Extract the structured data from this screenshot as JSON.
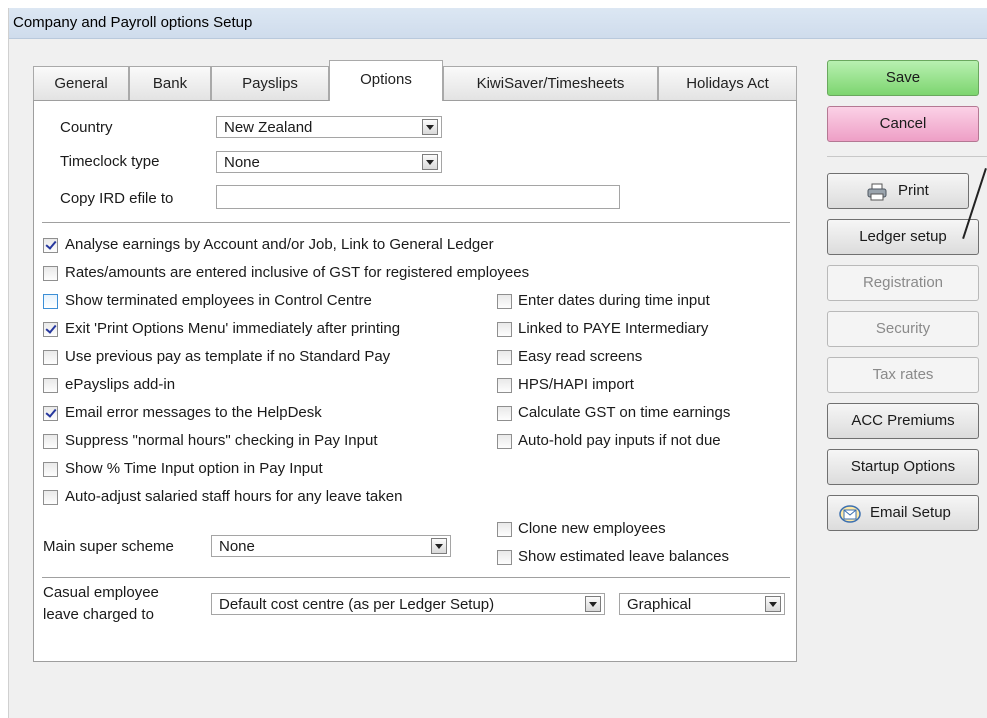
{
  "window": {
    "title": "Company and Payroll options Setup"
  },
  "tabs": [
    {
      "label": "General"
    },
    {
      "label": "Bank"
    },
    {
      "label": "Payslips"
    },
    {
      "label": "Options",
      "active": true
    },
    {
      "label": "KiwiSaver/Timesheets"
    },
    {
      "label": "Holidays Act"
    }
  ],
  "fields": {
    "country": {
      "label": "Country",
      "value": "New Zealand"
    },
    "timeclock": {
      "label": "Timeclock type",
      "value": "None"
    },
    "ird_efile": {
      "label": "Copy IRD efile to",
      "value": ""
    },
    "super_scheme": {
      "label": "Main super scheme",
      "value": "None"
    },
    "casual_leave": {
      "label_line1": "Casual employee",
      "label_line2": "leave charged to",
      "value": "Default cost centre (as per Ledger Setup)",
      "mode": "Graphical"
    }
  },
  "options_left": [
    {
      "label": "Analyse earnings by Account and/or Job, Link to General Ledger",
      "checked": true
    },
    {
      "label": "Rates/amounts are entered inclusive of GST for registered employees",
      "checked": false
    },
    {
      "label": "Show terminated employees in Control Centre",
      "checked": false
    },
    {
      "label": "Exit 'Print Options Menu' immediately after printing",
      "checked": true
    },
    {
      "label": "Use previous pay as template if no Standard Pay",
      "checked": false
    },
    {
      "label": "ePayslips add-in",
      "checked": false
    },
    {
      "label": "Email error messages to the HelpDesk",
      "checked": true
    },
    {
      "label": "Suppress \"normal hours\" checking in Pay Input",
      "checked": false
    },
    {
      "label": "Show % Time Input option in Pay Input",
      "checked": false
    },
    {
      "label": "Auto-adjust salaried staff hours for any leave taken",
      "checked": false
    }
  ],
  "options_right": [
    {
      "label": "Enter dates during time input",
      "checked": false
    },
    {
      "label": "Linked to PAYE Intermediary",
      "checked": false
    },
    {
      "label": "Easy read screens",
      "checked": false
    },
    {
      "label": "HPS/HAPI import",
      "checked": false
    },
    {
      "label": "Calculate GST on time earnings",
      "checked": false
    },
    {
      "label": "Auto-hold pay inputs if not due",
      "checked": false
    }
  ],
  "options_bottom": [
    {
      "label": "Clone new employees",
      "checked": false
    },
    {
      "label": "Show estimated leave balances",
      "checked": false
    }
  ],
  "buttons": {
    "save": "Save",
    "cancel": "Cancel",
    "print": "Print",
    "ledger_setup": "Ledger setup",
    "registration": "Registration",
    "security": "Security",
    "tax_rates": "Tax rates",
    "acc_premiums": "ACC Premiums",
    "startup_options": "Startup Options",
    "email_setup": "Email Setup"
  },
  "colors": {
    "save": "#86d97a",
    "cancel": "#f2a9cd",
    "title_bar": "#d6e3f1"
  },
  "icons": [
    "printer-icon",
    "envelope-icon",
    "dropdown-arrow-icon",
    "checkmark-icon"
  ]
}
